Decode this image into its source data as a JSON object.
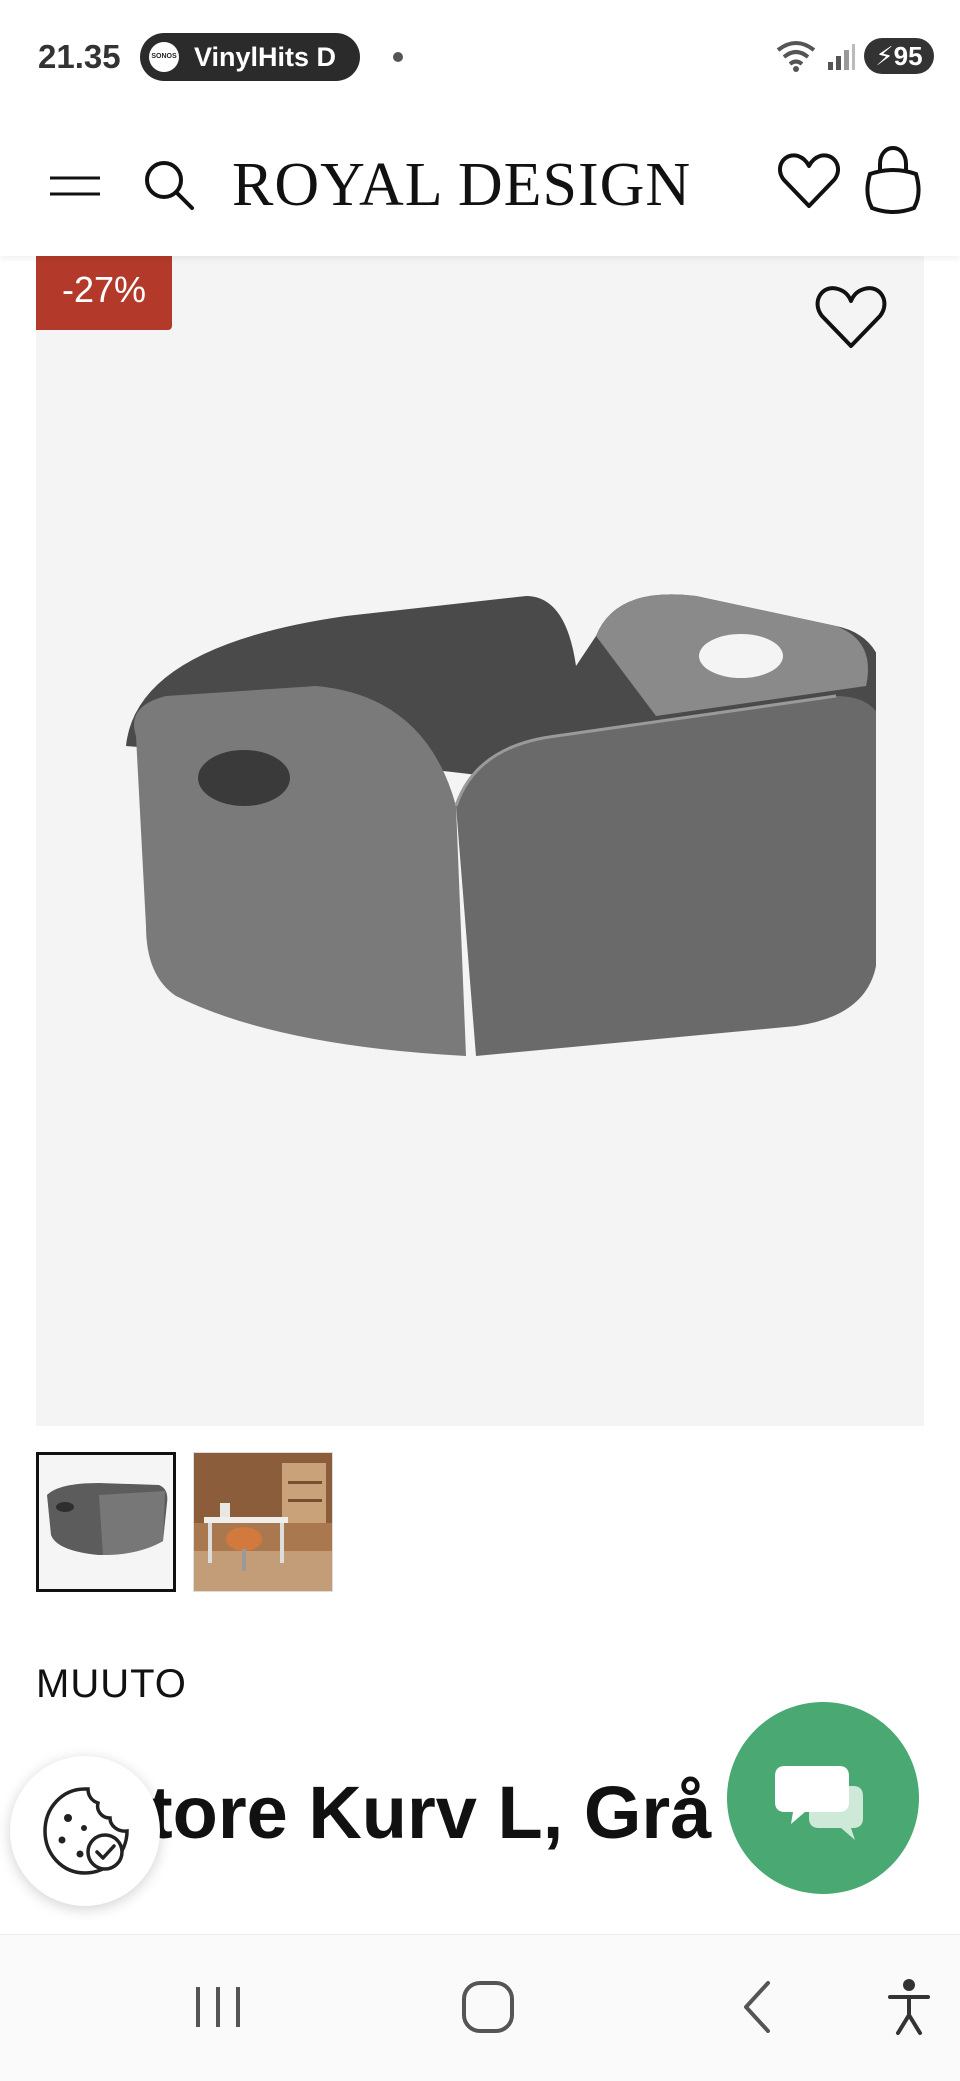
{
  "status_bar": {
    "time": "21.35",
    "media_app_logo": "SONOS",
    "media_title": "VinylHits D",
    "battery": "95",
    "icons": [
      "wifi-icon",
      "signal-icon",
      "battery-icon"
    ]
  },
  "header": {
    "brand": "ROYAL DESIGN",
    "icons": [
      "menu-icon",
      "search-icon",
      "heart-icon",
      "shopping-bag-icon"
    ]
  },
  "product": {
    "discount": "-27%",
    "brand": "MUUTO",
    "title": "Restore Kurv L, Grå",
    "visible_title": "tore Kurv L, Grå",
    "thumbnails": [
      "basket-thumbnail",
      "room-scene-thumbnail"
    ]
  },
  "colors": {
    "discount_badge": "#b33a2b",
    "chat_button": "#4aa873",
    "image_background": "#f4f4f4"
  },
  "floating": {
    "icons": [
      "cookie-icon",
      "chat-icon"
    ]
  },
  "nav_bar": {
    "icons": [
      "recent-apps-icon",
      "home-icon",
      "back-icon",
      "accessibility-icon"
    ]
  }
}
